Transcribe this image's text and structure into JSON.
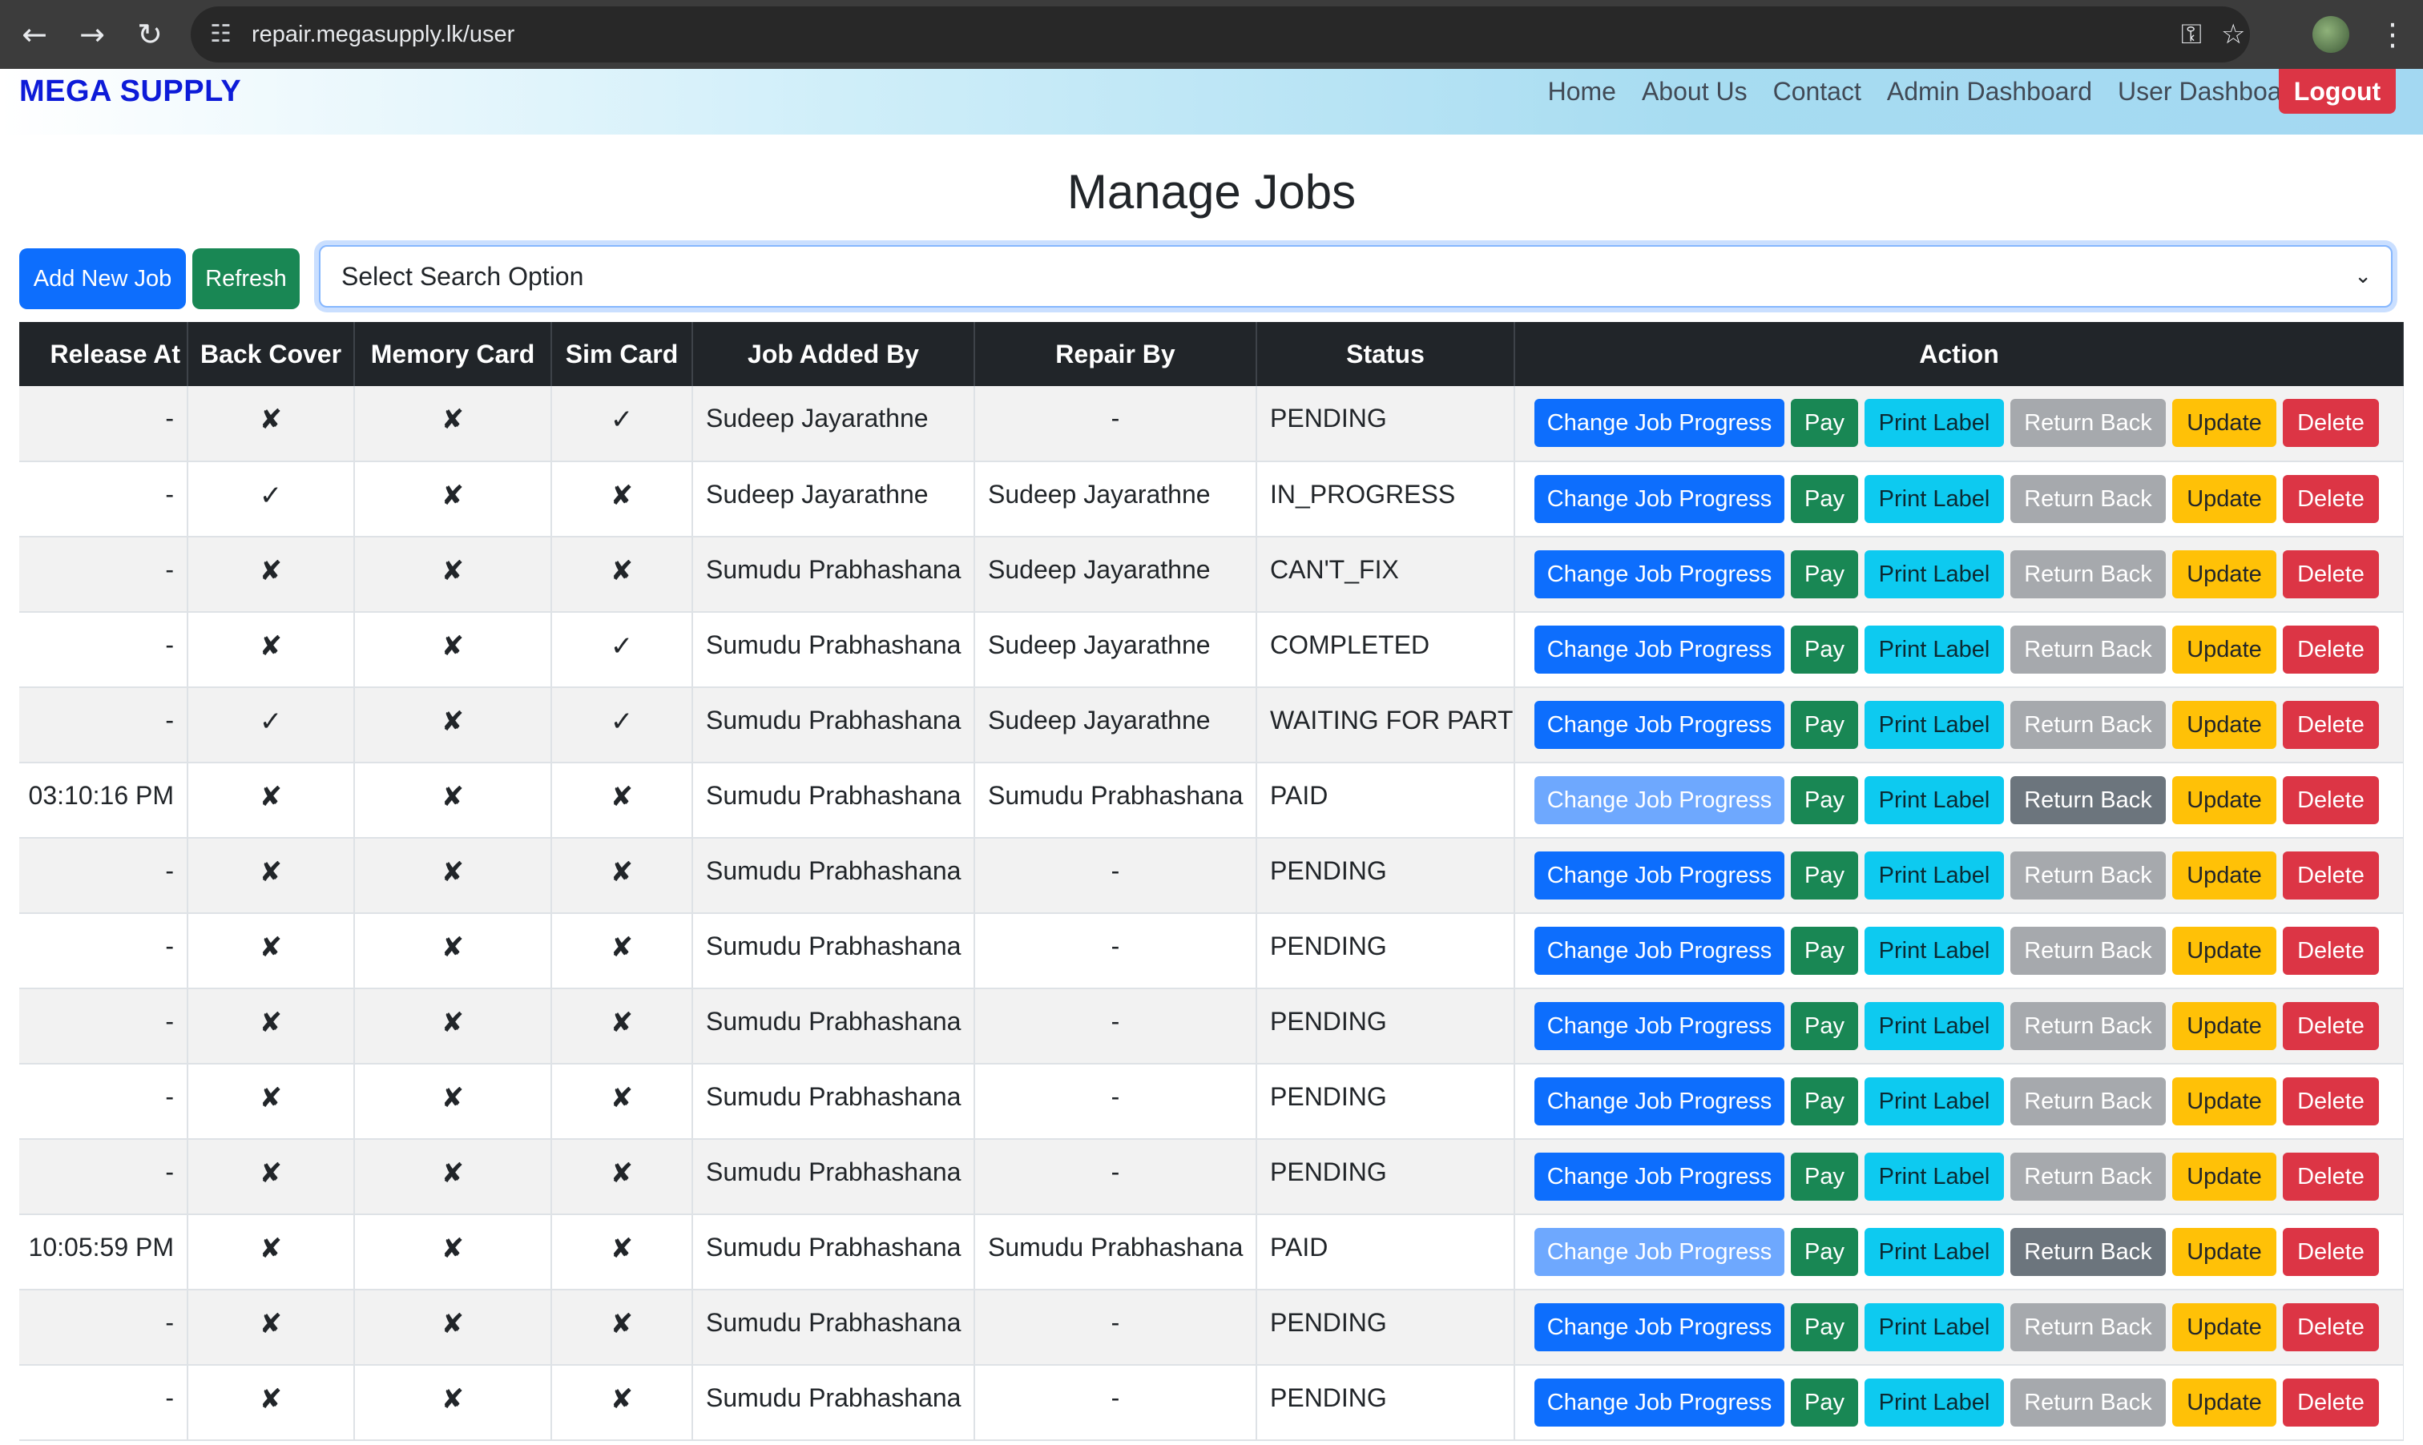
{
  "browser": {
    "url": "repair.megasupply.lk/user",
    "back_icon": "←",
    "forward_icon": "→",
    "reload_icon": "↻",
    "tune_icon": "☷",
    "key_icon": "⚿",
    "star_icon": "☆",
    "menu_icon": "⋮"
  },
  "nav": {
    "brand": "MEGA SUPPLY",
    "links": [
      "Home",
      "About Us",
      "Contact",
      "Admin Dashboard",
      "User Dashboard"
    ],
    "logout": "Logout"
  },
  "page": {
    "title": "Manage Jobs",
    "add_button": "Add New Job",
    "refresh_button": "Refresh",
    "search_placeholder": "Select Search Option",
    "chevron_icon": "⌄"
  },
  "table": {
    "headers": [
      "Release At",
      "Back Cover",
      "Memory Card",
      "Sim Card",
      "Job Added By",
      "Repair By",
      "Status",
      "Action"
    ],
    "action_labels": {
      "change_progress": "Change Job Progress",
      "pay": "Pay",
      "print_label": "Print Label",
      "return_back": "Return Back",
      "update": "Update",
      "delete": "Delete"
    },
    "rows": [
      {
        "release_at": "-",
        "back_cover": "✘",
        "memory_card": "✘",
        "sim_card": "✓",
        "added_by": "Sudeep Jayarathne",
        "repair_by": "-",
        "status": "PENDING",
        "paid": false
      },
      {
        "release_at": "-",
        "back_cover": "✓",
        "memory_card": "✘",
        "sim_card": "✘",
        "added_by": "Sudeep Jayarathne",
        "repair_by": "Sudeep Jayarathne",
        "status": "IN_PROGRESS",
        "paid": false
      },
      {
        "release_at": "-",
        "back_cover": "✘",
        "memory_card": "✘",
        "sim_card": "✘",
        "added_by": "Sumudu Prabhashana",
        "repair_by": "Sudeep Jayarathne",
        "status": "CAN'T_FIX",
        "paid": false
      },
      {
        "release_at": "-",
        "back_cover": "✘",
        "memory_card": "✘",
        "sim_card": "✓",
        "added_by": "Sumudu Prabhashana",
        "repair_by": "Sudeep Jayarathne",
        "status": "COMPLETED",
        "paid": false
      },
      {
        "release_at": "-",
        "back_cover": "✓",
        "memory_card": "✘",
        "sim_card": "✓",
        "added_by": "Sumudu Prabhashana",
        "repair_by": "Sudeep Jayarathne",
        "status": "WAITING FOR PART",
        "paid": false
      },
      {
        "release_at": "03:10:16 PM",
        "back_cover": "✘",
        "memory_card": "✘",
        "sim_card": "✘",
        "added_by": "Sumudu Prabhashana",
        "repair_by": "Sumudu Prabhashana",
        "status": "PAID",
        "paid": true
      },
      {
        "release_at": "-",
        "back_cover": "✘",
        "memory_card": "✘",
        "sim_card": "✘",
        "added_by": "Sumudu Prabhashana",
        "repair_by": "-",
        "status": "PENDING",
        "paid": false
      },
      {
        "release_at": "-",
        "back_cover": "✘",
        "memory_card": "✘",
        "sim_card": "✘",
        "added_by": "Sumudu Prabhashana",
        "repair_by": "-",
        "status": "PENDING",
        "paid": false
      },
      {
        "release_at": "-",
        "back_cover": "✘",
        "memory_card": "✘",
        "sim_card": "✘",
        "added_by": "Sumudu Prabhashana",
        "repair_by": "-",
        "status": "PENDING",
        "paid": false
      },
      {
        "release_at": "-",
        "back_cover": "✘",
        "memory_card": "✘",
        "sim_card": "✘",
        "added_by": "Sumudu Prabhashana",
        "repair_by": "-",
        "status": "PENDING",
        "paid": false
      },
      {
        "release_at": "-",
        "back_cover": "✘",
        "memory_card": "✘",
        "sim_card": "✘",
        "added_by": "Sumudu Prabhashana",
        "repair_by": "-",
        "status": "PENDING",
        "paid": false
      },
      {
        "release_at": "10:05:59 PM",
        "back_cover": "✘",
        "memory_card": "✘",
        "sim_card": "✘",
        "added_by": "Sumudu Prabhashana",
        "repair_by": "Sumudu Prabhashana",
        "status": "PAID",
        "paid": true
      },
      {
        "release_at": "-",
        "back_cover": "✘",
        "memory_card": "✘",
        "sim_card": "✘",
        "added_by": "Sumudu Prabhashana",
        "repair_by": "-",
        "status": "PENDING",
        "paid": false
      },
      {
        "release_at": "-",
        "back_cover": "✘",
        "memory_card": "✘",
        "sim_card": "✘",
        "added_by": "Sumudu Prabhashana",
        "repair_by": "-",
        "status": "PENDING",
        "paid": false
      }
    ]
  },
  "colors": {
    "primary": "#0d6efd",
    "success": "#198754",
    "info": "#0dcaf0",
    "secondary": "#6c757d",
    "warning": "#ffc107",
    "danger": "#dc3545",
    "brand": "#0d1bd8"
  }
}
